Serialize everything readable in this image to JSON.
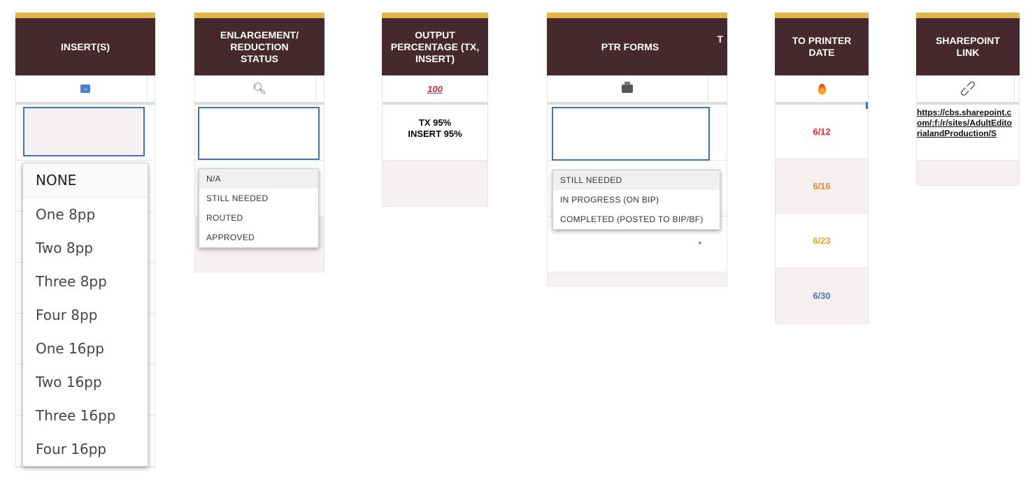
{
  "columns": {
    "inserts": {
      "header": "INSERT(S)",
      "icon": "left-right-arrow-icon",
      "options": [
        "NONE",
        "One 8pp",
        "Two 8pp",
        "Three 8pp",
        "Four 8pp",
        "One 16pp",
        "Two 16pp",
        "Three 16pp",
        "Four 16pp"
      ]
    },
    "enlargement": {
      "header": "ENLARGEMENT/ REDUCTION STATUS",
      "icon": "magnifier-icon",
      "options": [
        "N/A",
        "STILL NEEDED",
        "ROUTED",
        "APPROVED"
      ]
    },
    "output": {
      "header": "OUTPUT PERCENTAGE (TX, INSERT)",
      "icon": "hundred-points-icon",
      "value_line1": "TX 95%",
      "value_line2": "INSERT 95%"
    },
    "ptr": {
      "header": "PTR FORMS",
      "header_clip": "T",
      "icon": "printer-icon",
      "options": [
        "STILL NEEDED",
        "IN PROGRESS (ON BIP)",
        "COMPLETED (POSTED TO BIP/BF)"
      ]
    },
    "printer_date": {
      "header": "TO PRINTER DATE",
      "icon": "fire-icon",
      "dates": [
        {
          "value": "6/12",
          "color": "#e8262e"
        },
        {
          "value": "6/16",
          "color": "#e8892a"
        },
        {
          "value": "6/23",
          "color": "#e0a72b"
        },
        {
          "value": "6/30",
          "color": "#3e74c4"
        }
      ]
    },
    "sharepoint": {
      "header": "SHAREPOINT LINK",
      "icon": "link-icon",
      "link": "https://cbs.sharepoint.com/:f:/r/sites/AdultEditorialandProduction/S"
    }
  },
  "colors": {
    "header_bg": "#46292f",
    "accent_bar": "#e3b545",
    "selection": "#3f72c0",
    "row_shade": "#f6f1f0"
  }
}
